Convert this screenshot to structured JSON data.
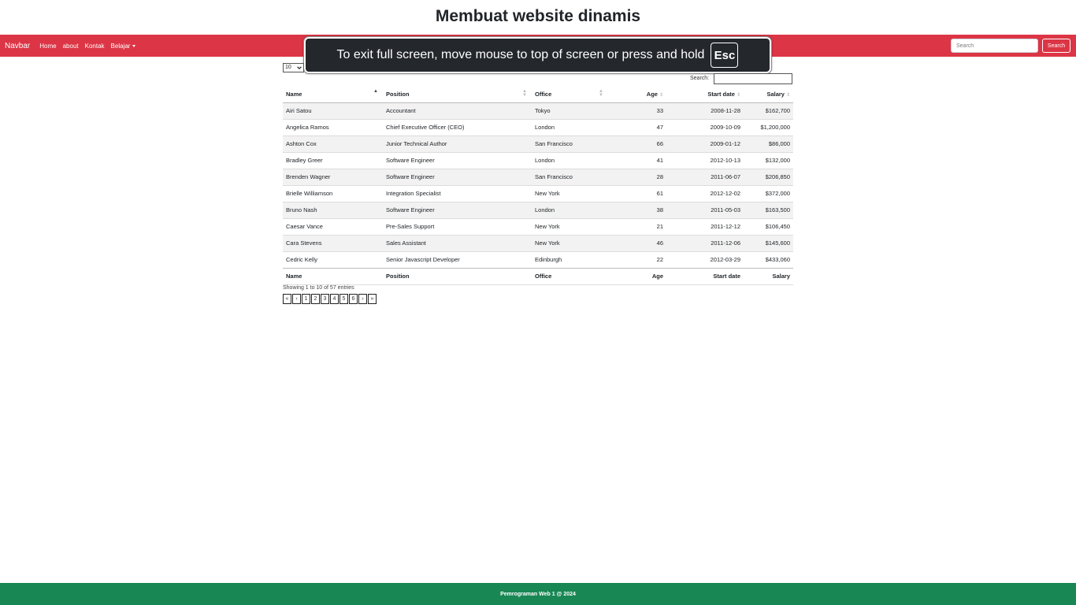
{
  "page": {
    "title": "Membuat website dinamis"
  },
  "navbar": {
    "brand": "Navbar",
    "links": [
      "Home",
      "about",
      "Kontak",
      "Belajar"
    ],
    "search_placeholder": "Search",
    "search_button": "Search",
    "color": "#dc3545"
  },
  "fullscreen_notice": {
    "text": "To exit full screen, move mouse to top of screen or press and hold",
    "key": "Esc"
  },
  "table_controls": {
    "page_length": "10",
    "search_label": "Search:"
  },
  "table": {
    "columns": [
      "Name",
      "Position",
      "Office",
      "Age",
      "Start date",
      "Salary"
    ],
    "rows": [
      [
        "Airi Satou",
        "Accountant",
        "Tokyo",
        "33",
        "2008-11-28",
        "$162,700"
      ],
      [
        "Angelica Ramos",
        "Chief Executive Officer (CEO)",
        "London",
        "47",
        "2009-10-09",
        "$1,200,000"
      ],
      [
        "Ashton Cox",
        "Junior Technical Author",
        "San Francisco",
        "66",
        "2009-01-12",
        "$86,000"
      ],
      [
        "Bradley Greer",
        "Software Engineer",
        "London",
        "41",
        "2012-10-13",
        "$132,000"
      ],
      [
        "Brenden Wagner",
        "Software Engineer",
        "San Francisco",
        "28",
        "2011-06-07",
        "$206,850"
      ],
      [
        "Brielle Williamson",
        "Integration Specialist",
        "New York",
        "61",
        "2012-12-02",
        "$372,000"
      ],
      [
        "Bruno Nash",
        "Software Engineer",
        "London",
        "38",
        "2011-05-03",
        "$163,500"
      ],
      [
        "Caesar Vance",
        "Pre-Sales Support",
        "New York",
        "21",
        "2011-12-12",
        "$106,450"
      ],
      [
        "Cara Stevens",
        "Sales Assistant",
        "New York",
        "46",
        "2011-12-06",
        "$145,600"
      ],
      [
        "Cedric Kelly",
        "Senior Javascript Developer",
        "Edinburgh",
        "22",
        "2012-03-29",
        "$433,060"
      ]
    ]
  },
  "info": "Showing 1 to 10 of 57 entries",
  "pagination": [
    "«",
    "‹",
    "1",
    "2",
    "3",
    "4",
    "5",
    "6",
    "›",
    "»"
  ],
  "footer": {
    "text": "Pemrograman Web 1 @ 2024",
    "color": "#198754"
  }
}
